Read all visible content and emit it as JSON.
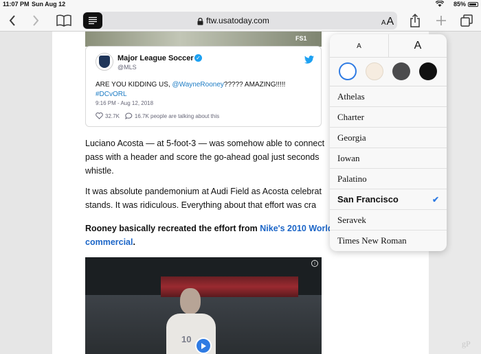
{
  "status": {
    "time": "11:07 PM",
    "date": "Sun Aug 12",
    "battery": "85%"
  },
  "toolbar": {
    "url": "ftw.usatoday.com",
    "aa_label": "A"
  },
  "video_top": {
    "badge": "FS1"
  },
  "tweet": {
    "name": "Major League Soccer",
    "handle": "@MLS",
    "text_prefix": "ARE YOU KIDDING US, ",
    "mention": "@WayneRooney",
    "text_suffix": "????? AMAZING!!!!!",
    "hashtag": "#DCvORL",
    "timestamp": "9:16 PM - Aug 12, 2018",
    "likes": "32.7K",
    "talking": "16.7K people are talking about this"
  },
  "article": {
    "p1": [
      "Luciano Acosta — at 5-foot-3 — was somehow able to connect",
      "pass with a header and score the go-ahead goal just seconds",
      "whistle."
    ],
    "p2": [
      "It was absolute pandemonium at Audi Field as Acosta celebrat",
      "stands. It was ridiculous. Everything about that effort was cra"
    ],
    "p3_prefix": "Rooney basically recreated the effort from ",
    "p3_link1": "Nike's 2010 World",
    "p3_link2": "commercial",
    "p3_suffix": "."
  },
  "player": {
    "jersey_number": "10"
  },
  "watermark": "gP",
  "popover": {
    "size_small": "A",
    "size_large": "A",
    "themes": [
      "white",
      "sepia",
      "gray",
      "black"
    ],
    "selected_theme": "white",
    "fonts": [
      "Athelas",
      "Charter",
      "Georgia",
      "Iowan",
      "Palatino",
      "San Francisco",
      "Seravek",
      "Times New Roman"
    ],
    "selected_font": "San Francisco",
    "accent": "#2f7be3"
  }
}
